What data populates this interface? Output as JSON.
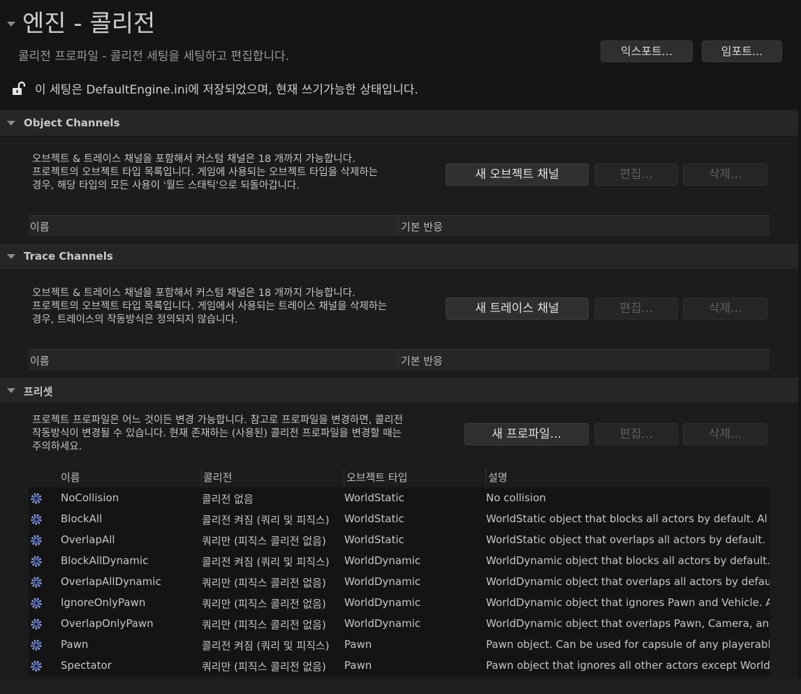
{
  "header": {
    "title": "엔진 - 콜리전",
    "subtitle": "콜리전 프로파일 - 콜리전 세팅을 세팅하고 편집합니다.",
    "export_label": "익스포트...",
    "import_label": "임포트...",
    "saved_note": "이 세팅은 DefaultEngine.ini에 저장되었으며, 현재 쓰기가능한 상태입니다."
  },
  "object_channels": {
    "label": "Object Channels",
    "desc": [
      "오브젝트 & 트레이스 채널을 포함해서 커스텀 채널은 18 개까지 가능합니다.",
      "프로젝트의 오브젝트 타입 목록입니다. 게임에 사용되는 오브젝트 타입을 삭제하는",
      "경우, 해당 타입의 모든 사용이 '월드 스태틱'으로 되돌아갑니다."
    ],
    "new_label": "새 오브젝트 채널",
    "edit_label": "편집...",
    "delete_label": "삭제...",
    "col_name": "이름",
    "col_default": "기본 반응"
  },
  "trace_channels": {
    "label": "Trace Channels",
    "desc": [
      "오브젝트 & 트레이스 채널을 포함해서 커스텀 채널은 18 개까지 가능합니다.",
      "프로젝트의 오브젝트 타입 목록입니다. 게임에서 사용되는 트레이스 채널을 삭제하는",
      "경우, 트레이스의 작동방식은 정의되지 않습니다."
    ],
    "new_label": "새 트레이스 채널",
    "edit_label": "편집...",
    "delete_label": "삭제...",
    "col_name": "이름",
    "col_default": "기본 반응"
  },
  "presets": {
    "label": "프리셋",
    "desc": [
      "프로젝트 프로파일은 어느 것이든 변경 가능합니다. 참고로 프로파일을 변경하면, 콜리전",
      "작동방식이 변경될 수 있습니다. 현재 존재하는 (사용된) 콜리전 프로파일을 변경할 때는",
      "주의하세요."
    ],
    "new_label": "새 프로파일...",
    "edit_label": "편집...",
    "delete_label": "삭제...",
    "columns": [
      "이름",
      "콜리전",
      "오브젝트 타입",
      "설명"
    ],
    "rows": [
      {
        "name": "NoCollision",
        "collision": "콜리전 없음",
        "type": "WorldStatic",
        "desc": "No collision"
      },
      {
        "name": "BlockAll",
        "collision": "콜리전 켜짐 (쿼리 및 피직스)",
        "type": "WorldStatic",
        "desc": "WorldStatic object that blocks all actors by default. Al"
      },
      {
        "name": "OverlapAll",
        "collision": "쿼리만 (피직스 콜리전 없음)",
        "type": "WorldStatic",
        "desc": "WorldStatic object that overlaps all actors by default. ."
      },
      {
        "name": "BlockAllDynamic",
        "collision": "콜리전 켜짐 (쿼리 및 피직스)",
        "type": "WorldDynamic",
        "desc": "WorldDynamic object that blocks all actors by default."
      },
      {
        "name": "OverlapAllDynamic",
        "collision": "쿼리만 (피직스 콜리전 없음)",
        "type": "WorldDynamic",
        "desc": "WorldDynamic object that overlaps all actors by defau"
      },
      {
        "name": "IgnoreOnlyPawn",
        "collision": "쿼리만 (피직스 콜리전 없음)",
        "type": "WorldDynamic",
        "desc": "WorldDynamic object that ignores Pawn and Vehicle. A"
      },
      {
        "name": "OverlapOnlyPawn",
        "collision": "쿼리만 (피직스 콜리전 없음)",
        "type": "WorldDynamic",
        "desc": "WorldDynamic object that overlaps Pawn, Camera, and"
      },
      {
        "name": "Pawn",
        "collision": "콜리전 켜짐 (쿼리 및 피직스)",
        "type": "Pawn",
        "desc": "Pawn object. Can be used for capsule of any playerabl"
      },
      {
        "name": "Spectator",
        "collision": "쿼리만 (피직스 콜리전 없음)",
        "type": "Pawn",
        "desc": "Pawn object that ignores all other actors except World"
      }
    ]
  },
  "icons": {
    "title_collapse": "triangle-down-icon",
    "lock": "unlocked-padlock-icon",
    "row": "gear-icon"
  }
}
